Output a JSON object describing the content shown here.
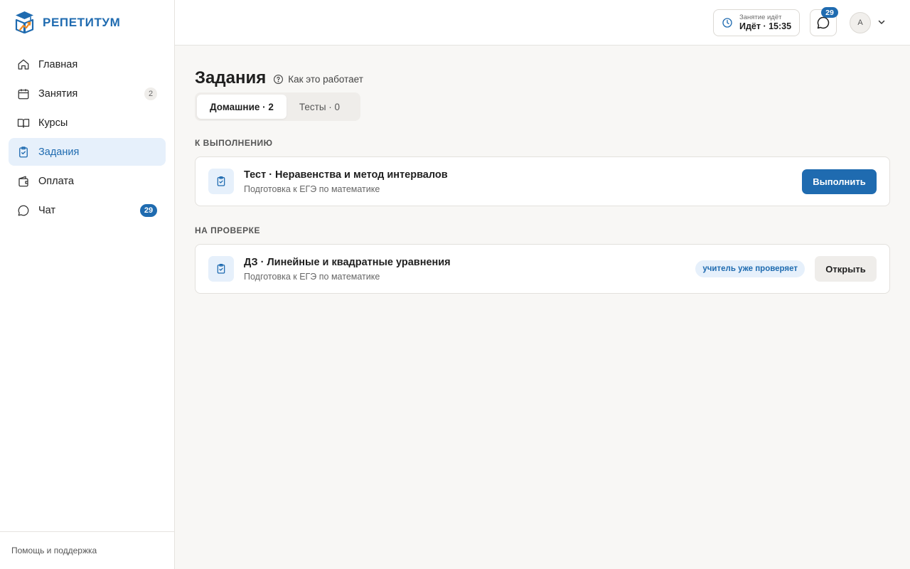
{
  "brand": {
    "name": "РЕПЕТИТУМ",
    "color": "#1f6bb0",
    "accent": "#f08a24"
  },
  "sidebar": {
    "items": [
      {
        "label": "Главная",
        "icon": "home-icon",
        "active": false,
        "badge": ""
      },
      {
        "label": "Занятия",
        "icon": "calendar-icon",
        "active": false,
        "badge": "2"
      },
      {
        "label": "Курсы",
        "icon": "book-icon",
        "active": false,
        "badge": ""
      },
      {
        "label": "Задания",
        "icon": "clipboard-check-icon",
        "active": true,
        "badge": ""
      },
      {
        "label": "Оплата",
        "icon": "wallet-icon",
        "active": false,
        "badge": ""
      },
      {
        "label": "Чат",
        "icon": "chat-icon",
        "active": false,
        "badge": "29"
      }
    ],
    "footer_link": "Помощь и поддержка"
  },
  "header": {
    "lesson_status_label": "Занятие идёт",
    "lesson_status_value": "Идёт · 15:35",
    "chat_badge": "29",
    "avatar_initial": "А"
  },
  "main": {
    "title": "Задания",
    "help_link": "Как это работает",
    "tabs": [
      {
        "label": "Домашние · 2",
        "active": true
      },
      {
        "label": "Тесты · 0",
        "active": false
      }
    ],
    "sections": [
      {
        "label": "К ВЫПОЛНЕНИЮ",
        "cards": [
          {
            "title": "Тест · Неравенства и метод интервалов",
            "subtitle": "Подготовка к ЕГЭ по математике",
            "action": "Выполнить",
            "status": ""
          }
        ]
      },
      {
        "label": "НА ПРОВЕРКЕ",
        "cards": [
          {
            "title": "ДЗ · Линейные и квадратные уравнения",
            "subtitle": "Подготовка к ЕГЭ по математике",
            "action": "Открыть",
            "status": "учитель уже проверяет"
          }
        ]
      }
    ]
  }
}
